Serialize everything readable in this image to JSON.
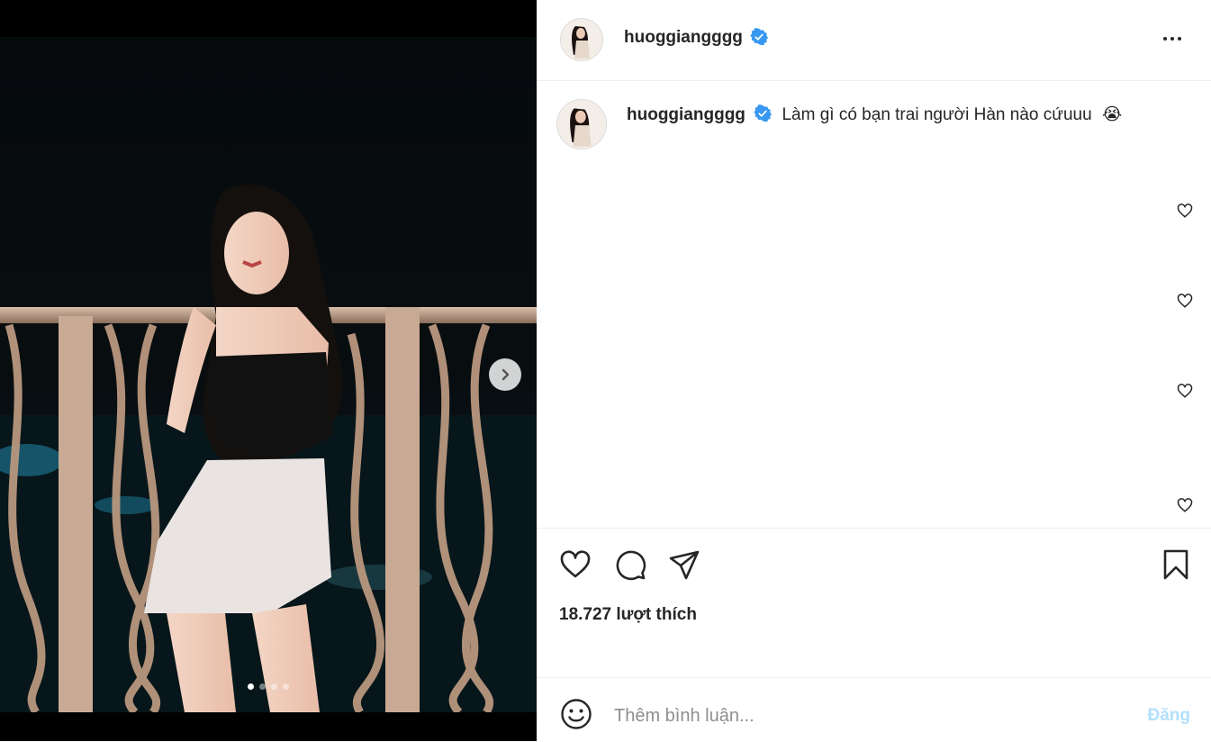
{
  "post": {
    "username": "huoggiangggg",
    "verified": true,
    "caption": "Làm gì có bạn trai người Hàn nào cứuuu",
    "caption_emoji": "😭",
    "likes_text": "18.727 lượt thích",
    "carousel": {
      "total": 4,
      "current": 1
    }
  },
  "comment": {
    "placeholder": "Thêm bình luận...",
    "post_label": "Đăng"
  },
  "colors": {
    "verified_blue": "#3897f0",
    "post_button_disabled": "#b2dffc",
    "text": "#262626",
    "muted": "#8e8e8e"
  },
  "icons": [
    "verified-badge-icon",
    "more-options-icon",
    "heart-icon",
    "comment-icon",
    "share-icon",
    "bookmark-icon",
    "emoji-icon",
    "chevron-right-icon"
  ]
}
